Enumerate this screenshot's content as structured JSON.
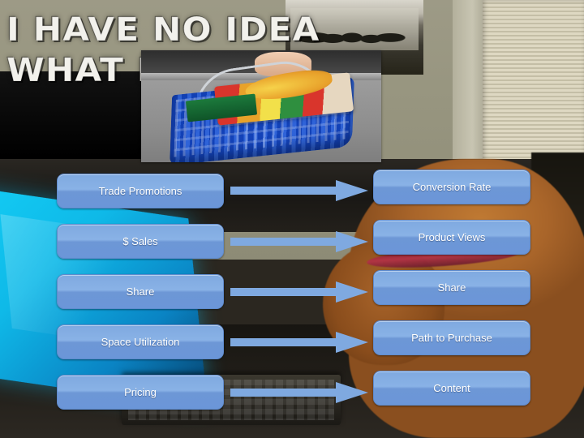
{
  "slide": {
    "meme_caption": {
      "line1": "I HAVE NO IDEA",
      "line2": "WHAT I'M"
    },
    "background_alt": "golden retriever dog standing at an office desk with laptop and keyboard",
    "inset_image_alt": "hand holding a blue plastic shopping basket filled with groceries",
    "colors": {
      "button_fill": "#7fa9e0",
      "button_border": "#5f8bcd",
      "button_text": "#ffffff",
      "arrow_fill": "#7fa9e0",
      "laptop_glow": "#13cdf5"
    }
  },
  "diagram": {
    "left_column": [
      {
        "label": "Trade Promotions"
      },
      {
        "label": "$ Sales"
      },
      {
        "label": "Share"
      },
      {
        "label": "Space Utilization"
      },
      {
        "label": "Pricing"
      }
    ],
    "right_column": [
      {
        "label": "Conversion Rate"
      },
      {
        "label": "Product Views"
      },
      {
        "label": "Share"
      },
      {
        "label": "Path to Purchase"
      },
      {
        "label": "Content"
      }
    ],
    "connectors": [
      {
        "name": "arrow-right-1"
      },
      {
        "name": "arrow-right-2"
      },
      {
        "name": "arrow-right-3"
      },
      {
        "name": "arrow-right-4"
      },
      {
        "name": "arrow-right-5"
      }
    ]
  }
}
